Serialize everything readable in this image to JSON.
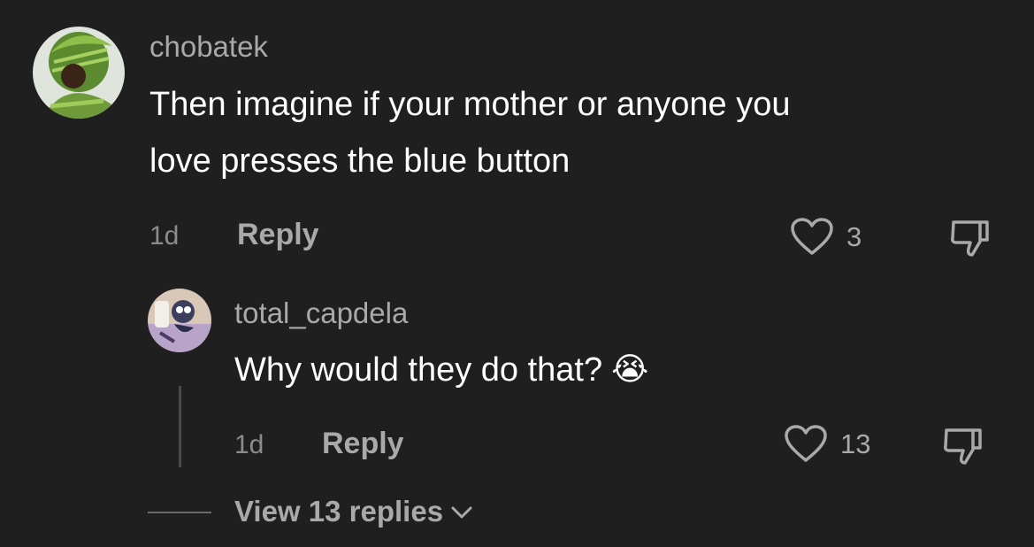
{
  "comments": [
    {
      "username": "chobatek",
      "text_lines": [
        "Then imagine if your mother or anyone you",
        "love presses the blue button"
      ],
      "time": "1d",
      "reply_label": "Reply",
      "likes": "3"
    }
  ],
  "reply": {
    "username": "total_capdela",
    "text": "Why would they do that?",
    "emoji": "😭",
    "time": "1d",
    "reply_label": "Reply",
    "likes": "13"
  },
  "view_replies_label": "View 13 replies"
}
